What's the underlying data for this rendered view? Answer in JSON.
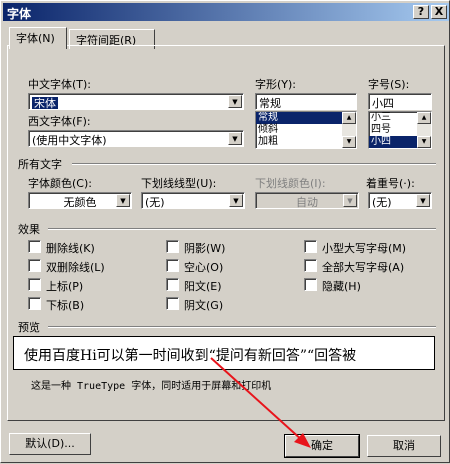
{
  "window": {
    "title": "字体",
    "help_btn": "?",
    "close_btn": "X"
  },
  "tabs": [
    {
      "label": "字体(N)"
    },
    {
      "label": "字符间距(R)"
    }
  ],
  "font_panel": {
    "cn_font_label": "中文字体(T):",
    "cn_font_value": "宋体",
    "west_font_label": "西文字体(F):",
    "west_font_value": "(使用中文字体)",
    "style_label": "字形(Y):",
    "style_value": "常规",
    "style_options": [
      "常规",
      "倾斜",
      "加粗"
    ],
    "size_label": "字号(S):",
    "size_value": "小四",
    "size_options": [
      "小三",
      "四号",
      "小四"
    ]
  },
  "all_text": {
    "section_label": "所有文字",
    "color_label": "字体颜色(C):",
    "color_value": "无颜色",
    "underline_label": "下划线线型(U):",
    "underline_value": "(无)",
    "underline_color_label": "下划线颜色(I):",
    "underline_color_value": "自动",
    "emphasis_label": "着重号(·):",
    "emphasis_value": "(无)"
  },
  "effects": {
    "section_label": "效果",
    "items": [
      {
        "label": "删除线(K)"
      },
      {
        "label": "双删除线(L)"
      },
      {
        "label": "上标(P)"
      },
      {
        "label": "下标(B)"
      },
      {
        "label": "阴影(W)"
      },
      {
        "label": "空心(O)"
      },
      {
        "label": "阳文(E)"
      },
      {
        "label": "阴文(G)"
      },
      {
        "label": "小型大写字母(M)"
      },
      {
        "label": "全部大写字母(A)"
      },
      {
        "label": "隐藏(H)"
      }
    ]
  },
  "preview": {
    "section_label": "预览",
    "text": "使用百度Hi可以第一时间收到“提问有新回答”“回答被",
    "note": "这是一种 TrueType 字体，同时适用于屏幕和打印机"
  },
  "buttons": {
    "default": "默认(D)...",
    "ok": "确定",
    "cancel": "取消"
  },
  "colors": {
    "title_start": "#0a246a",
    "title_end": "#a6caf0",
    "selection": "#0a246a",
    "arrow": "#e8141b"
  }
}
